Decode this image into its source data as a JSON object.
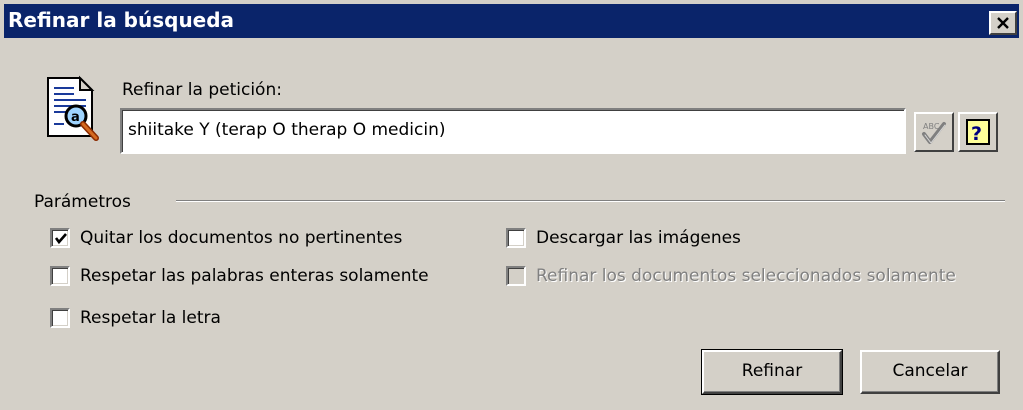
{
  "window": {
    "title": "Refinar la búsqueda",
    "close_label": "Cerrar"
  },
  "query": {
    "label": "Refinar la petición:",
    "value": "shiitake Y (terap O therap O medicin)",
    "spell_icon": "spellcheck-abc-icon",
    "help_icon": "help-question-icon"
  },
  "params": {
    "group_label": "Parámetros",
    "options": [
      {
        "label": "Quitar los documentos no pertinentes",
        "checked": true,
        "enabled": true
      },
      {
        "label": "Descargar las imágenes",
        "checked": false,
        "enabled": true
      },
      {
        "label": "Respetar las palabras enteras solamente",
        "checked": false,
        "enabled": true
      },
      {
        "label": "Refinar los documentos seleccionados solamente",
        "checked": false,
        "enabled": false
      },
      {
        "label": "Respetar la letra",
        "checked": false,
        "enabled": true
      }
    ]
  },
  "buttons": {
    "ok": "Refinar",
    "cancel": "Cancelar"
  },
  "colors": {
    "titlebar": "#0a246a",
    "face": "#d4d0c8",
    "disabled_text": "#808080"
  }
}
